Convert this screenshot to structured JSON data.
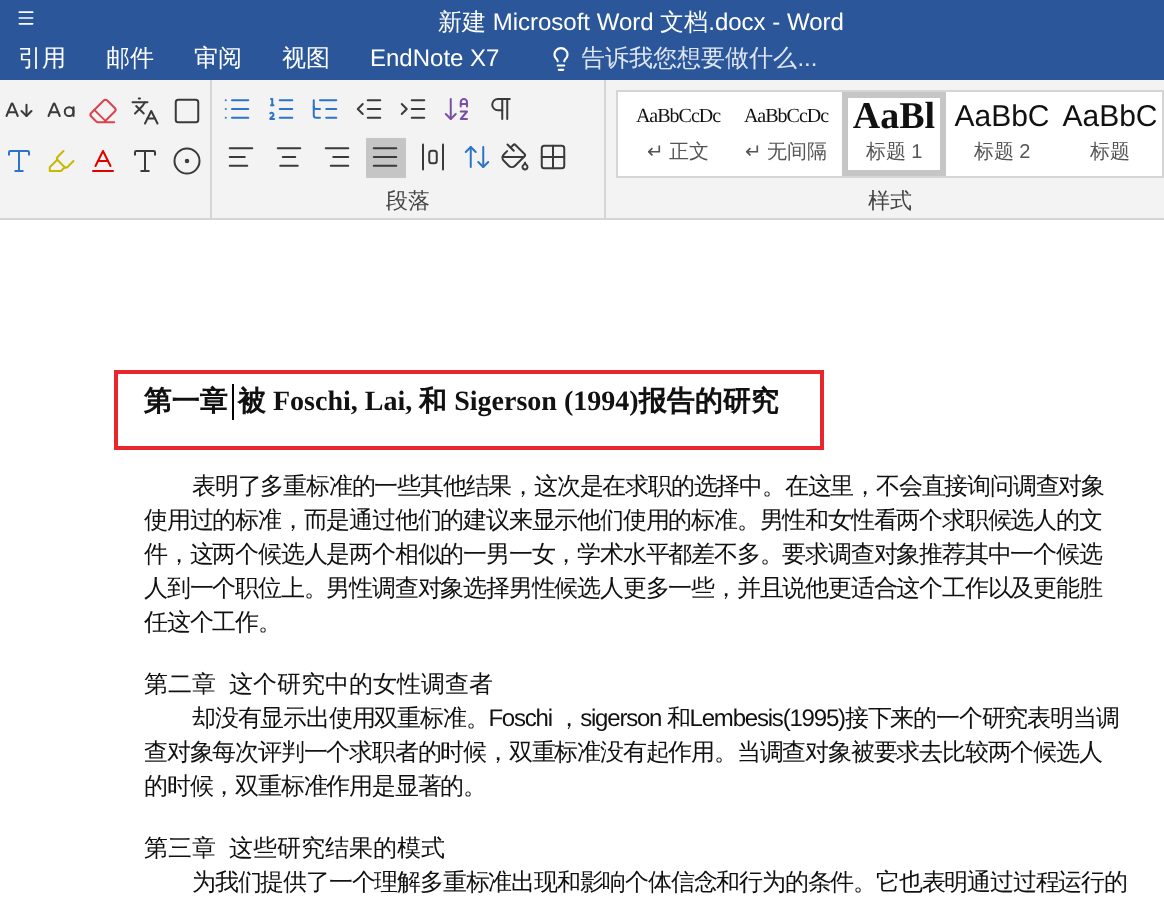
{
  "window": {
    "title": "新建 Microsoft Word 文档.docx - Word"
  },
  "tabs": [
    "引用",
    "邮件",
    "审阅",
    "视图",
    "EndNote X7"
  ],
  "tell_me": {
    "placeholder": "告诉我您想要做什么..."
  },
  "paragraph_group": {
    "label": "段落",
    "alignment_buttons": [
      {
        "kind": "left",
        "selected": false
      },
      {
        "kind": "center",
        "selected": false
      },
      {
        "kind": "right",
        "selected": false
      },
      {
        "kind": "justify",
        "selected": true
      },
      {
        "kind": "distributed",
        "selected": false
      }
    ]
  },
  "styles_group": {
    "label": "样式",
    "styles": [
      {
        "preview": "AaBbCcDc",
        "name": "↵ 正文",
        "kind": "serif",
        "selected": false
      },
      {
        "preview": "AaBbCcDc",
        "name": "↵ 无间隔",
        "kind": "serif",
        "selected": false
      },
      {
        "preview": "AaBl",
        "name": "标题 1",
        "kind": "heading",
        "selected": true
      },
      {
        "preview": "AaBbC",
        "name": "标题 2",
        "kind": "sans",
        "selected": false
      },
      {
        "preview": "AaBbC",
        "name": "标题",
        "kind": "sans",
        "selected": false
      }
    ]
  },
  "document": {
    "heading": {
      "before_cursor": "第一章",
      "after_cursor": "被 Foschi, Lai,  和  Sigerson (1994)报告的研究"
    },
    "blocks": [
      {
        "kind": "body",
        "text": "表明了多重标准的一些其他结果，这次是在求职的选择中。在这里，不会直接询问调查对象使用过的标准，而是通过他们的建议来显示他们使用的标准。男性和女性看两个求职候选人的文件，这两个候选人是两个相似的一男一女，学术水平都差不多。要求调查对象推荐其中一个候选人到一个职位上。男性调查对象选择男性候选人更多一些，并且说他更适合这个工作以及更能胜任这个工作。"
      },
      {
        "kind": "subheading",
        "text": "第二章  这个研究中的女性调查者"
      },
      {
        "kind": "body",
        "text": "却没有显示出使用双重标准。Foschi ，sigerson 和Lembesis(1995)接下来的一个研究表明当调查对象每次评判一个求职者的时候，双重标准没有起作用。当调查对象被要求去比较两个候选人的时候，双重标准作用是显著的。"
      },
      {
        "kind": "subheading",
        "text": "第三章  这些研究结果的模式"
      },
      {
        "kind": "body",
        "text": "为我们提供了一个理解多重标准出现和影响个体信念和行为的条件。它也表明通过过程运行的"
      }
    ]
  }
}
